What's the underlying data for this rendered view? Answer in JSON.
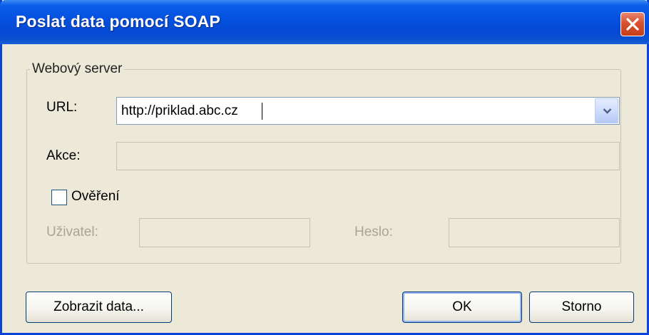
{
  "window": {
    "title": "Poslat data pomocí SOAP"
  },
  "group": {
    "legend": "Webový server"
  },
  "url": {
    "label": "URL:",
    "value": "http://priklad.abc.cz"
  },
  "action": {
    "label": "Akce:",
    "value": ""
  },
  "auth": {
    "checkbox_label": "Ověření",
    "checked": false
  },
  "user": {
    "label": "Uživatel:",
    "value": ""
  },
  "password": {
    "label": "Heslo:",
    "value": ""
  },
  "buttons": {
    "show_data": "Zobrazit data...",
    "ok": "OK",
    "cancel": "Storno"
  },
  "colors": {
    "titlebar": "#0552e0",
    "dialog_bg": "#ece9d8",
    "close_button": "#d9512d",
    "disabled_text": "#a8a598"
  }
}
